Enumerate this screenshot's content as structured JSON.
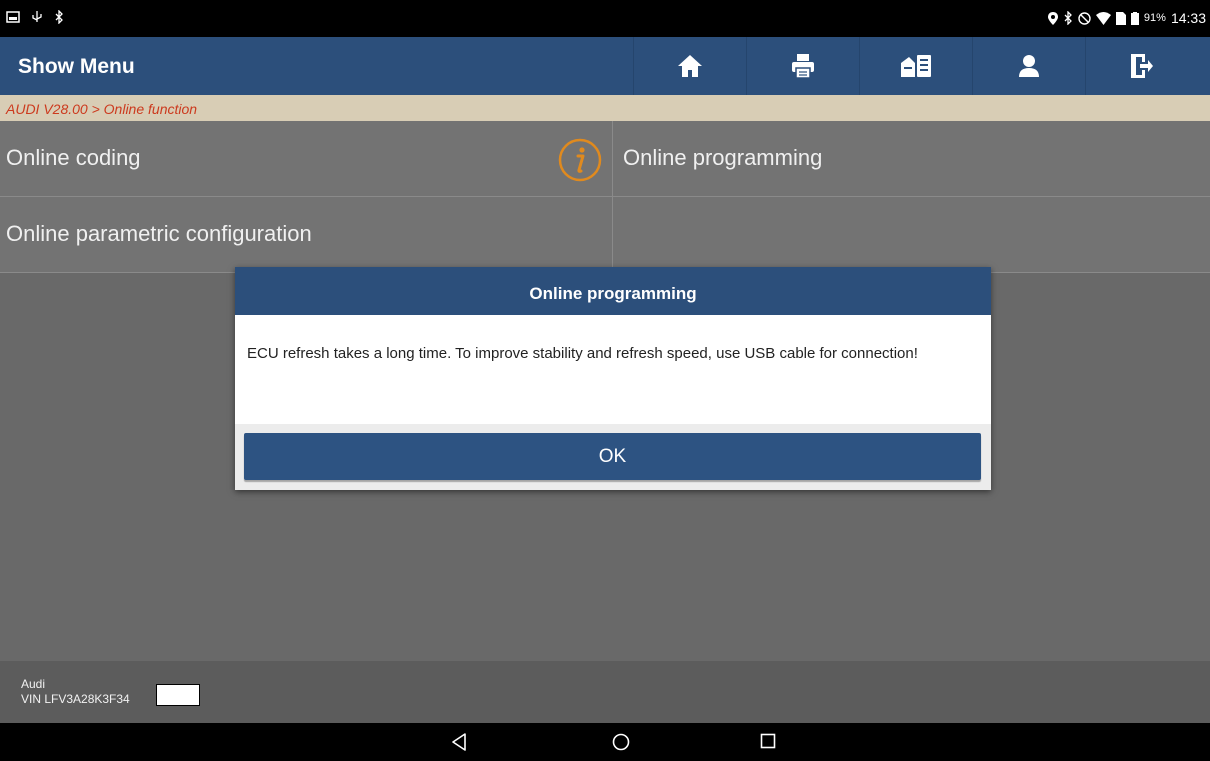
{
  "status_bar": {
    "battery": "91%",
    "time": "14:33"
  },
  "header": {
    "title": "Show Menu",
    "tools": [
      "home-icon",
      "print-icon",
      "report-icon",
      "user-icon",
      "exit-icon"
    ]
  },
  "breadcrumb": "AUDI V28.00 > Online function",
  "menu": {
    "items": [
      {
        "label": "Online coding"
      },
      {
        "label": "Online programming"
      },
      {
        "label": "Online parametric configuration"
      },
      {
        "label": ""
      }
    ]
  },
  "dialog": {
    "title": "Online programming",
    "message": "ECU refresh takes a long time. To improve stability and refresh speed, use USB cable for connection!",
    "ok_label": "OK"
  },
  "vehicle": {
    "brand": "Audi",
    "vin": "VIN LFV3A28K3F34"
  },
  "colors": {
    "header": "#2c4f7b",
    "breadcrumb_bg": "#d8cdb5",
    "breadcrumb_text": "#cc3a1e",
    "info_icon": "#e08a1e"
  }
}
